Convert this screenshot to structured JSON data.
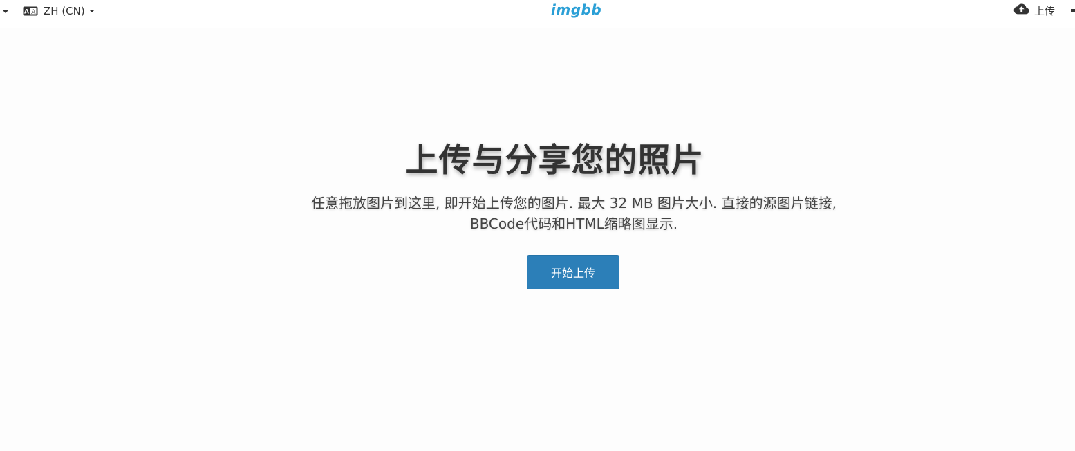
{
  "header": {
    "language_label": "ZH (CN)",
    "logo_text": "imgbb",
    "upload_label": "上传"
  },
  "hero": {
    "title": "上传与分享您的照片",
    "description": "任意拖放图片到这里, 即开始上传您的图片. 最大 32 MB 图片大小. 直接的源图片链接, BBCode代码和HTML缩略图显示.",
    "start_button_label": "开始上传"
  },
  "colors": {
    "logo": "#2a9fd6",
    "button": "#2c7fb8",
    "text": "#333333"
  },
  "icons": {
    "language": "language-icon",
    "upload": "cloud-upload-icon"
  }
}
